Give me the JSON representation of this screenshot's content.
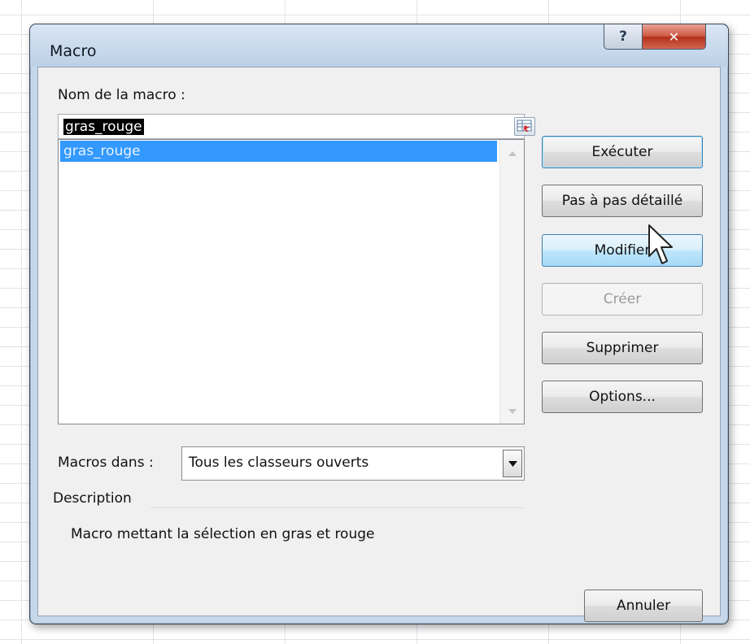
{
  "window": {
    "title": "Macro",
    "help_glyph": "?",
    "close_glyph": "✕"
  },
  "macro_name": {
    "label": "Nom de la macro :",
    "value": "gras_rouge"
  },
  "macro_list": {
    "items": [
      "gras_rouge"
    ],
    "selected_index": 0
  },
  "buttons": {
    "run": "Exécuter",
    "step_into": "Pas à pas détaillé",
    "edit": "Modifier",
    "create": "Créer",
    "delete": "Supprimer",
    "options": "Options...",
    "cancel": "Annuler"
  },
  "macros_in": {
    "label": "Macros dans :",
    "value": "Tous les classeurs ouverts"
  },
  "description": {
    "label": "Description",
    "text": "Macro mettant la sélection en gras et rouge"
  },
  "colors": {
    "selection": "#3399ff",
    "close_button": "#c8442f",
    "dialog_background": "#f0f0f0"
  },
  "icons": {
    "collapse_dialog": "range-selector-icon",
    "close": "close-icon",
    "help": "help-icon",
    "cursor": "mouse-pointer-icon"
  }
}
